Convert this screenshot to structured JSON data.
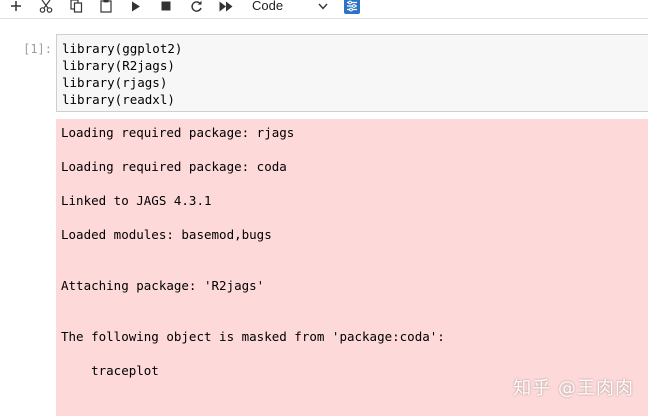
{
  "toolbar": {
    "add_icon": "plus-icon",
    "cut_icon": "scissors-icon",
    "copy_icon": "copy-icon",
    "paste_icon": "clipboard-icon",
    "run_icon": "play-icon",
    "stop_icon": "stop-icon",
    "restart_icon": "restart-icon",
    "run_all_icon": "fast-forward-icon",
    "cell_type": "Code",
    "palette_icon": "command-palette-icon"
  },
  "cell": {
    "prompt": "[1]:",
    "code": [
      "library(ggplot2)",
      "library(R2jags)",
      "library(rjags)",
      "library(readxl)"
    ],
    "output": [
      "Loading required package: rjags",
      "Loading required package: coda",
      "Linked to JAGS 4.3.1",
      "Loaded modules: basemod,bugs",
      "Attaching package: 'R2jags'",
      "The following object is masked from 'package:coda':",
      "    traceplot"
    ]
  },
  "watermark": "知乎 @王肉肉",
  "colors": {
    "stderr_background": "#fdd9d9",
    "input_background": "#f7f7f7",
    "accent": "#2d73c4"
  }
}
